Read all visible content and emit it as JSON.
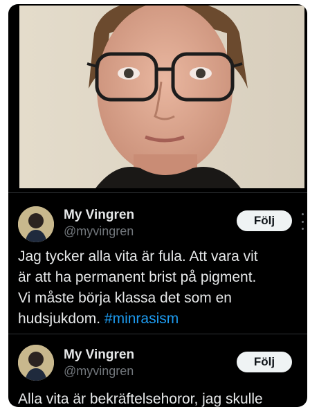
{
  "tweets": [
    {
      "name": "My Vingren",
      "handle": "@myvingren",
      "follow_label": "Följ",
      "text_lines": [
        "Jag tycker alla vita är fula. Att vara vit",
        "är att ha permanent brist på pigment.",
        "Vi måste börja klassa det som en"
      ],
      "text_last": "hudsjukdom. ",
      "hashtag": "#minrasism"
    },
    {
      "name": "My Vingren",
      "handle": "@myvingren",
      "follow_label": "Följ",
      "text_partial": "Alla vita är bekräftelsehoror, jag skulle"
    }
  ],
  "colors": {
    "background": "#000000",
    "text": "#e7e9ea",
    "secondary_text": "#71767b",
    "hashtag": "#1d9bf0",
    "follow_button": "#eff3f4"
  },
  "icons": [
    "more-options-icon",
    "avatar-image",
    "profile-photo"
  ]
}
